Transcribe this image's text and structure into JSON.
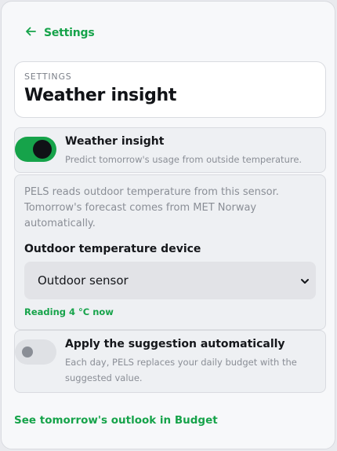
{
  "nav": {
    "back_label": "Settings"
  },
  "header": {
    "eyebrow": "SETTINGS",
    "title": "Weather insight"
  },
  "weather_toggle": {
    "title": "Weather insight",
    "description": "Predict tomorrow's usage from outside temperature.",
    "enabled": true
  },
  "device": {
    "description": "PELS reads outdoor temperature from this sensor. Tomorrow's forecast comes from MET Norway automatically.",
    "label": "Outdoor temperature device",
    "selected": "Outdoor sensor",
    "reading": "Reading 4 °C now"
  },
  "auto_apply": {
    "title": "Apply the suggestion automatically",
    "description": "Each day, PELS replaces your daily budget with the suggested value.",
    "enabled": false
  },
  "footer": {
    "link_label": "See tomorrow's outlook in Budget"
  },
  "colors": {
    "accent": "#16a34a",
    "toggle_off": "#dfe1e5"
  },
  "icons": {
    "back": "arrow-left-icon",
    "select": "chevron-down-icon"
  }
}
